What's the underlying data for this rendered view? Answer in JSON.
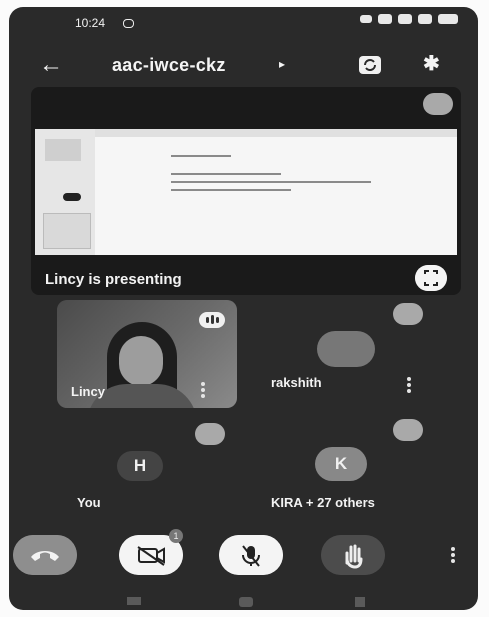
{
  "status_bar": {
    "time": "10:24"
  },
  "app_bar": {
    "meeting_code": "aac-iwce-ckz",
    "caret": "▸"
  },
  "presentation": {
    "presenting_text": "Lincy is presenting"
  },
  "participants": {
    "lincy": {
      "name": "Lincy"
    },
    "rakshith": {
      "name": "rakshith"
    },
    "you": {
      "initial": "H",
      "label": "You"
    },
    "others": {
      "initial": "K",
      "label": "KIRA + 27 others"
    }
  },
  "controls": {
    "video_badge": "1"
  },
  "icons": [
    "arrow-back-icon",
    "switch-camera-icon",
    "bluetooth-icon",
    "mic-off-icon",
    "fullscreen-icon",
    "audio-bars-icon",
    "more-vert-icon",
    "end-call-icon",
    "video-off-icon",
    "raise-hand-icon"
  ],
  "colors": {
    "background": "#2a2a2a",
    "end_call": "#8e8e8e",
    "control_white": "#f4f4f4"
  }
}
